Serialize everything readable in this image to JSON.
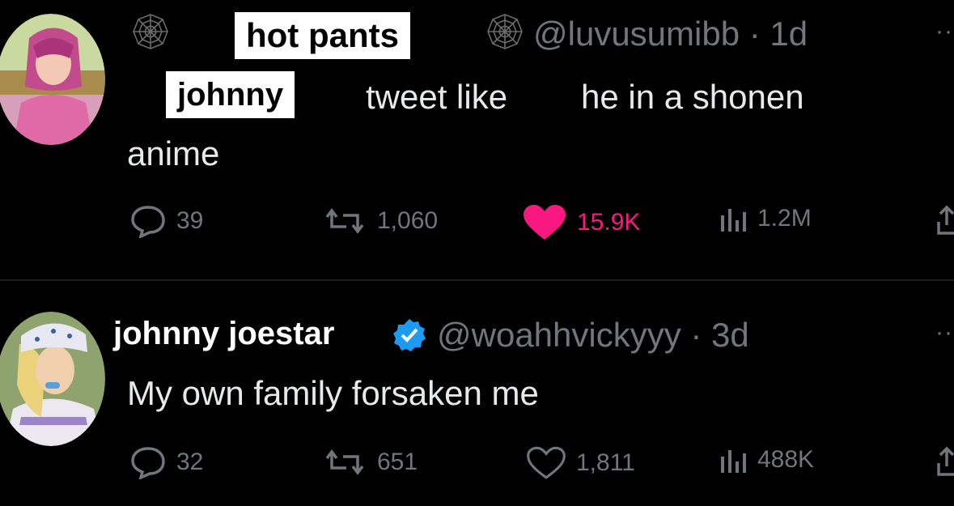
{
  "tweets": [
    {
      "display_name_overlay": "hot pants",
      "handle": "@luvusumibb",
      "time": "· 1d",
      "text_overlay": "johnny",
      "text_line1": "tweet like",
      "text_line1b": "he in a shonen",
      "text_line2": "anime",
      "replies": "39",
      "reposts": "1,060",
      "likes": "15.9K",
      "views": "1.2M",
      "liked": true
    },
    {
      "display_name": "johnny joestar",
      "handle": "@woahhvickyyy",
      "time": "· 3d",
      "text": "My own family forsaken me",
      "replies": "32",
      "reposts": "651",
      "likes": "1,811",
      "views": "488K",
      "liked": false
    }
  ],
  "colors": {
    "background": "#000000",
    "muted": "#71767b",
    "like": "#f91880",
    "verified": "#1d9bf0"
  },
  "icons": [
    "spiderweb-icon",
    "reply-icon",
    "repost-icon",
    "like-icon",
    "views-icon",
    "share-icon",
    "verified-icon",
    "more-icon"
  ]
}
